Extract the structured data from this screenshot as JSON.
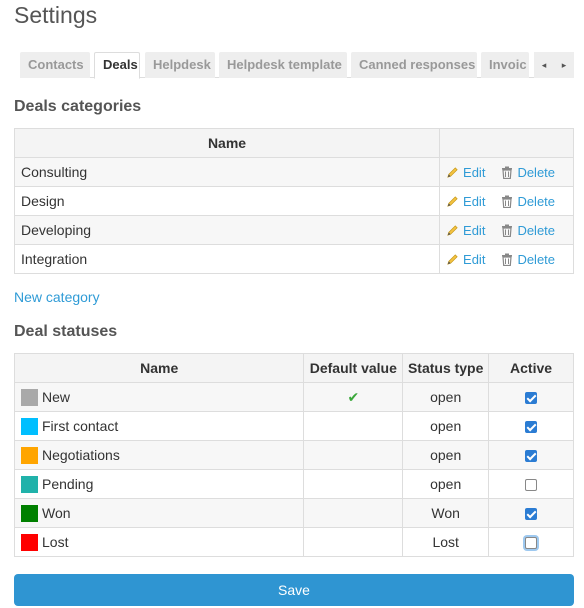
{
  "page": {
    "title": "Settings"
  },
  "tabs": {
    "items": [
      "Contacts",
      "Deals",
      "Helpdesk",
      "Helpdesk template",
      "Canned responses",
      "Invoic"
    ],
    "active": "Deals",
    "prev_icon": "◂",
    "next_icon": "▸"
  },
  "categories": {
    "title": "Deals categories",
    "header_name": "Name",
    "edit_label": "Edit",
    "delete_label": "Delete",
    "rows": [
      "Consulting",
      "Design",
      "Developing",
      "Integration"
    ],
    "new_link": "New category"
  },
  "statuses": {
    "title": "Deal statuses",
    "headers": {
      "name": "Name",
      "default": "Default value",
      "type": "Status type",
      "active": "Active"
    },
    "default_check_icon": "✔",
    "rows": [
      {
        "name": "New",
        "color": "#a9a9a9",
        "default": true,
        "type": "open",
        "active": true
      },
      {
        "name": "First contact",
        "color": "#00bfff",
        "default": false,
        "type": "open",
        "active": true
      },
      {
        "name": "Negotiations",
        "color": "#ffa500",
        "default": false,
        "type": "open",
        "active": true
      },
      {
        "name": "Pending",
        "color": "#20b2aa",
        "default": false,
        "type": "open",
        "active": false
      },
      {
        "name": "Won",
        "color": "#008000",
        "default": false,
        "type": "Won",
        "active": true
      },
      {
        "name": "Lost",
        "color": "#ff0000",
        "default": false,
        "type": "Lost",
        "active": false
      }
    ]
  },
  "save_label": "Save"
}
